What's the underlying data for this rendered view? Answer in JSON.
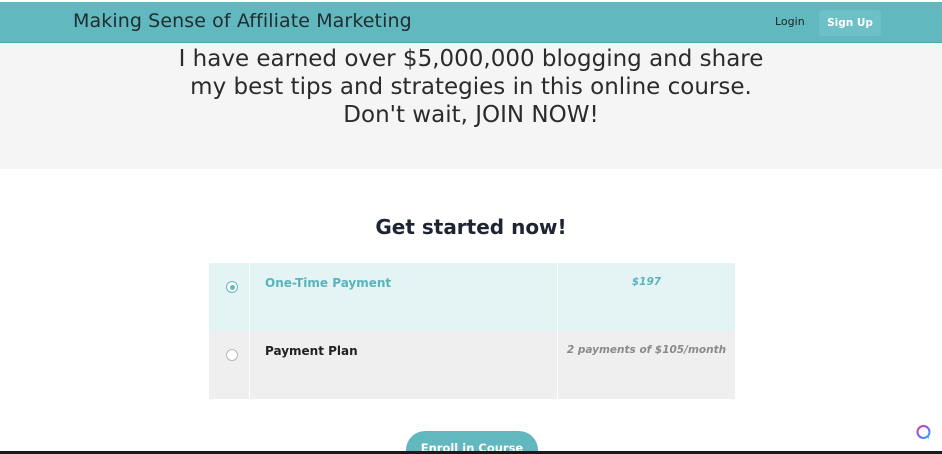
{
  "header": {
    "title": "Making Sense of Affiliate Marketing",
    "login_label": "Login",
    "signup_label": "Sign Up"
  },
  "hero": {
    "text": "I have earned over $5,000,000 blogging and share my best tips and strategies in this online course. Don't wait, JOIN NOW!"
  },
  "pricing": {
    "title": "Get started now!",
    "plans": [
      {
        "name": "One-Time Payment",
        "price": "$197",
        "selected": true
      },
      {
        "name": "Payment Plan",
        "price": "2 payments of $105/month",
        "selected": false
      }
    ],
    "enroll_label": "Enroll in Course"
  },
  "colors": {
    "accent": "#62b8bf",
    "selected_row": "#e4f4f5",
    "unselected_row": "#efefef",
    "hero_bg": "#f5f5f5"
  },
  "icons": {
    "chat_widget": "chat-bubble-icon"
  }
}
